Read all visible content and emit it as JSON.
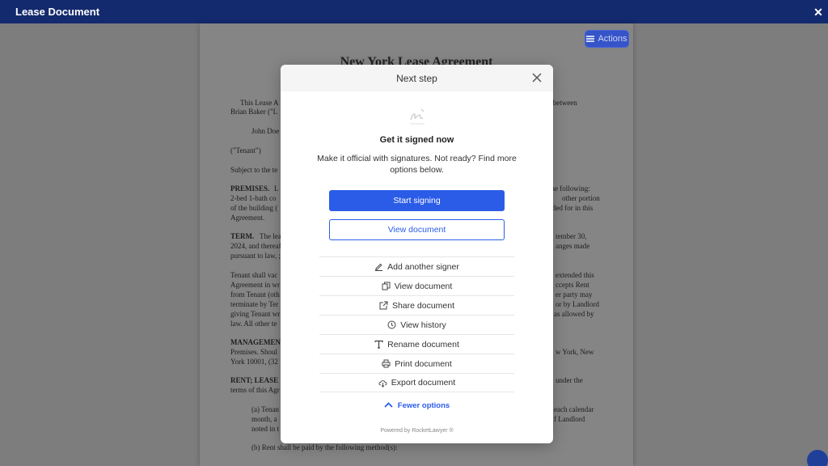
{
  "window": {
    "title": "Lease Document",
    "close_glyph": "✕"
  },
  "document": {
    "title": "New York Lease Agreement",
    "paragraphs": [
      "This Lease A",
      "d between",
      "Brian Baker (\"L",
      "John Doe",
      "(\"Tenant\")",
      "Subject to the te",
      "PREMISES.",
      "L",
      "the following:",
      "2-bed 1-bath co",
      "other portion",
      "of the building (",
      "ded for in this",
      "Agreement.",
      "TERM.",
      "The lea",
      "tember 30,",
      "2024, and thereaf",
      "anges made",
      "pursuant to law, ;",
      "Tenant shall vac",
      "extended this",
      "Agreement in wr",
      "ccepts Rent",
      "from Tenant (oth",
      "er party may",
      "terminate by Ter",
      "or by Landlord",
      "giving Tenant wr",
      "as allowed by",
      "law. All other te",
      "MANAGEMEN",
      "w York, New",
      "Premises. Shoul",
      "York 10001, (32",
      "RENT; LEASE",
      "under the",
      "terms of this Agr",
      "(a) Tenan",
      "each calendar",
      "month, a",
      "f Landlord",
      "noted in t",
      "(b) Rent shall be paid by the following method(s):"
    ]
  },
  "actions_button": {
    "label": "Actions"
  },
  "modal": {
    "title": "Next step",
    "heading": "Get it signed now",
    "subtext": "Make it official with signatures. Not ready? Find more options below.",
    "primary_button": "Start signing",
    "secondary_button": "View document",
    "options": [
      {
        "label": "Add another signer",
        "icon": "pen-icon"
      },
      {
        "label": "View document",
        "icon": "copy-icon"
      },
      {
        "label": "Share document",
        "icon": "share-icon"
      },
      {
        "label": "View history",
        "icon": "clock-icon"
      },
      {
        "label": "Rename document",
        "icon": "text-icon"
      },
      {
        "label": "Print document",
        "icon": "printer-icon"
      },
      {
        "label": "Export document",
        "icon": "cloud-download-icon"
      }
    ],
    "fewer_options": "Fewer options",
    "powered_by": "Powered by RocketLawyer ®"
  },
  "colors": {
    "accent": "#2b5ce8",
    "topbar": "#142a6e"
  }
}
